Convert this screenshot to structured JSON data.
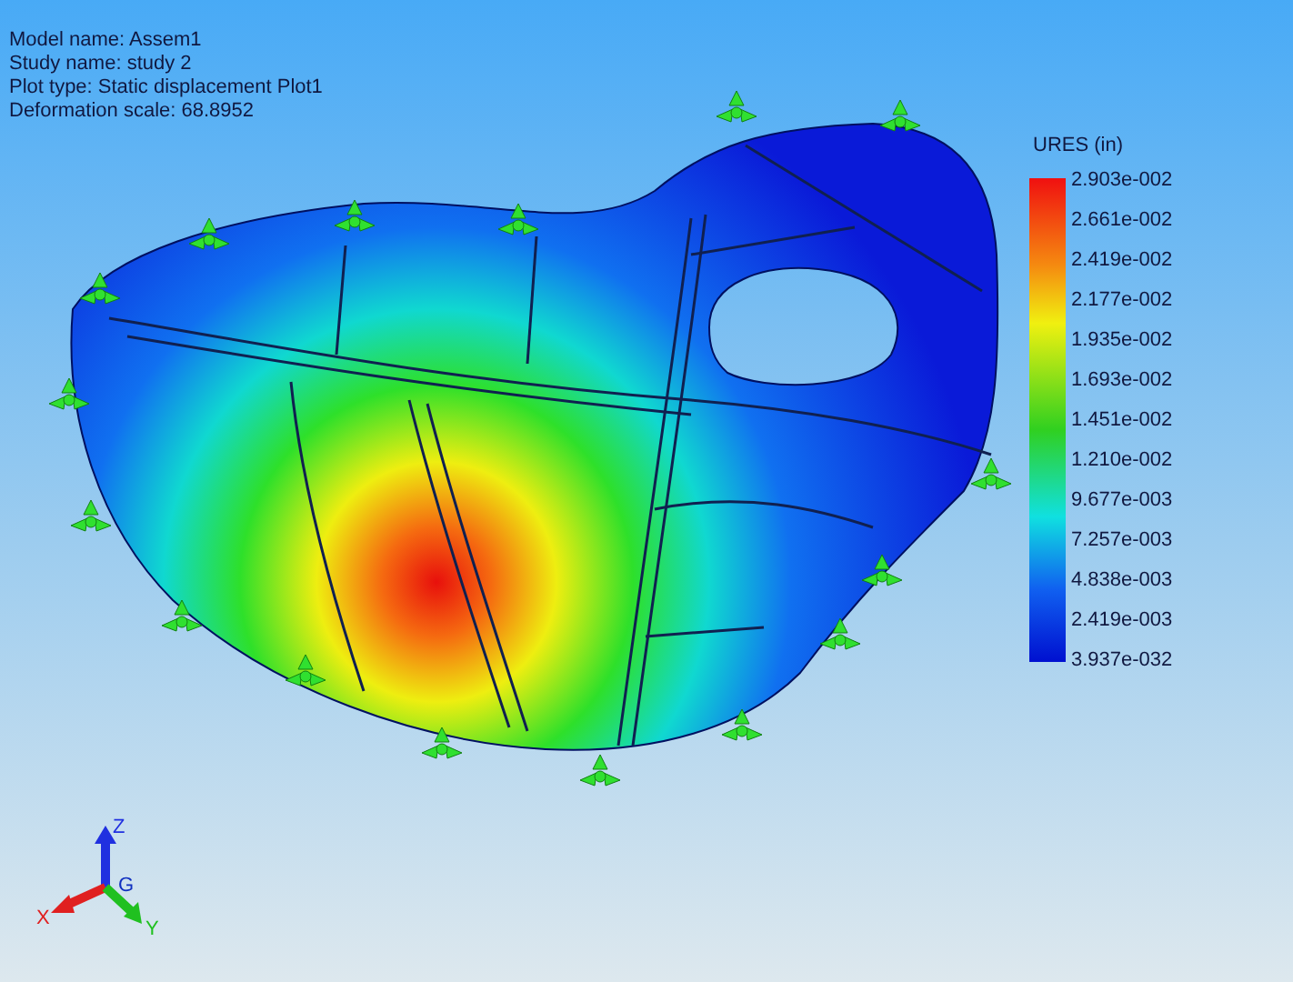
{
  "info": [
    "Model name: Assem1",
    "Study name: study 2",
    "Plot type: Static displacement Plot1",
    "Deformation scale: 68.8952"
  ],
  "legend": {
    "title": "URES (in)",
    "labels": [
      "2.903e-002",
      "2.661e-002",
      "2.419e-002",
      "2.177e-002",
      "1.935e-002",
      "1.693e-002",
      "1.451e-002",
      "1.210e-002",
      "9.677e-003",
      "7.257e-003",
      "4.838e-003",
      "2.419e-003",
      "3.937e-032"
    ]
  },
  "triad": {
    "z": "Z",
    "x": "X",
    "y": "Y",
    "origin": "G"
  }
}
